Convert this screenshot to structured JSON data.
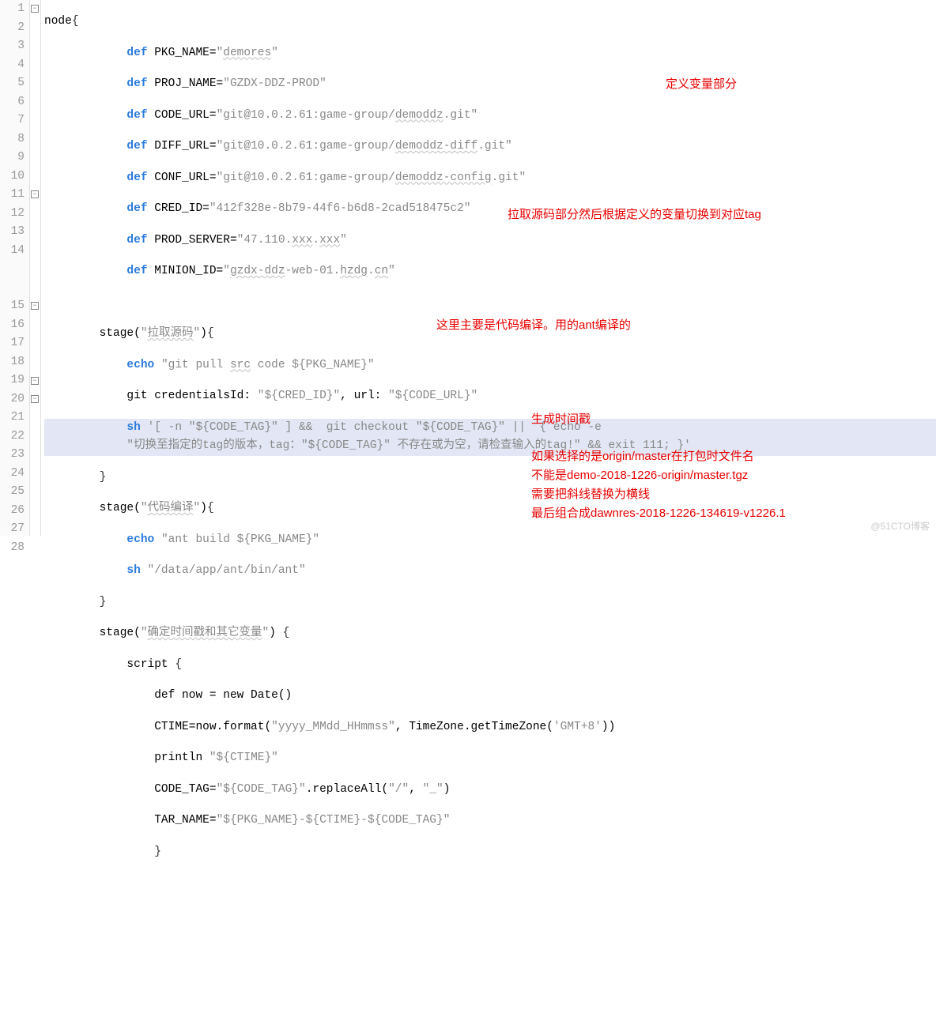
{
  "lines": [
    "1",
    "2",
    "3",
    "4",
    "5",
    "6",
    "7",
    "8",
    "9",
    "10",
    "11",
    "12",
    "13",
    "14",
    "15",
    "16",
    "17",
    "18",
    "19",
    "20",
    "21",
    "22",
    "23",
    "24",
    "25",
    "26",
    "27",
    "28"
  ],
  "c": {
    "node": "node",
    "def": "def",
    "pkg_name": "PKG_NAME=",
    "pkg_val": "\"demores\"",
    "proj_name": "PROJ_NAME=",
    "proj_val": "\"GZDX-DDZ-PROD\"",
    "code_url": "CODE_URL=",
    "code_val1": "\"git@10.0.2.61:game-group/",
    "code_val2": "demoddz",
    "code_val3": ".git\"",
    "diff_url": "DIFF_URL=",
    "diff_val1": "\"git@10.0.2.61:game-group/",
    "diff_val2": "demoddz-diff",
    "diff_val3": ".git\"",
    "conf_url": "CONF_URL=",
    "conf_val1": "\"git@10.0.2.61:game-group/",
    "conf_val2": "demoddz-config",
    "conf_val3": ".git\"",
    "cred_id": "CRED_ID=",
    "cred_val": "\"412f328e-8b79-44f6-b6d8-2cad518475c2\"",
    "prod_srv": "PROD_SERVER=",
    "prod_val1": "\"47.110.",
    "prod_val2": "xxx",
    "prod_val3": ".",
    "prod_val4": "xxx",
    "prod_val5": "\"",
    "minion": "MINION_ID=",
    "minion_val1": "\"",
    "minion_val2": "gzdx-ddz",
    "minion_val3": "-web-01.",
    "minion_val4": "hzdg",
    "minion_val5": ".",
    "minion_val6": "cn",
    "minion_val7": "\"",
    "stage": "stage",
    "stage1_label": "拉取源码",
    "echo": "echo",
    "echo1": "\"git pull ",
    "echo1b": "src",
    "echo1c": " code ${PKG_NAME}\"",
    "git_cred": "git credentialsId: ",
    "git_cred_v": "\"${CRED_ID}\"",
    "git_url": ", url: ",
    "git_url_v": "\"${CODE_URL}\"",
    "sh": "sh",
    "sh1": "'[ -n \"${CODE_TAG}\" ] &&  git checkout \"${CODE_TAG}\" ||  { echo -e",
    "sh1b": "\"切换至指定的tag的版本，tag：\"${CODE_TAG}\" 不存在或为空，请检查输入的tag!\" && exit 111; }'",
    "stage2_label": "代码编译",
    "echo2": "\"ant build ${PKG_NAME}\"",
    "sh2": "\"/data/app/ant/bin/ant\"",
    "stage3_label": "确定时间戳和其它变量",
    "script": "script",
    "now1": "def now = new Date()",
    "ctime": "CTIME=now.format(",
    "ctime_a": "\"yyyy_MMdd_HHmmss\"",
    "ctime_b": ", TimeZone.getTimeZone(",
    "ctime_c": "'GMT+8'",
    "ctime_d": "))",
    "println": "println ",
    "println_v": "\"${CTIME}\"",
    "codetag": "CODE_TAG=",
    "codetag_v": "\"${CODE_TAG}\"",
    "replace": ".replaceAll(",
    "replace_a": "\"/\"",
    "replace_b": ", ",
    "replace_c": "\"_\"",
    "replace_d": ")",
    "tarname": "TAR_NAME=",
    "tarname_v": "\"${PKG_NAME}-${CTIME}-${CODE_TAG}\"",
    "brace_o": "{",
    "brace_c": "}",
    "paren_oc": "()"
  },
  "anno": {
    "a1": "定义变量部分",
    "a2": "拉取源码部分然后根据定义的变量切换到对应tag",
    "a3": "这里主要是代码编译。用的ant编译的",
    "a4": "生成时间戳",
    "a5": "如果选择的是origin/master在打包时文件名",
    "a6": "不能是demo-2018-1226-origin/master.tgz",
    "a7": "需要把斜线替换为横线",
    "a8": "最后组合成dawnres-2018-1226-134619-v1226.1"
  },
  "watermark": "@51CTO博客"
}
